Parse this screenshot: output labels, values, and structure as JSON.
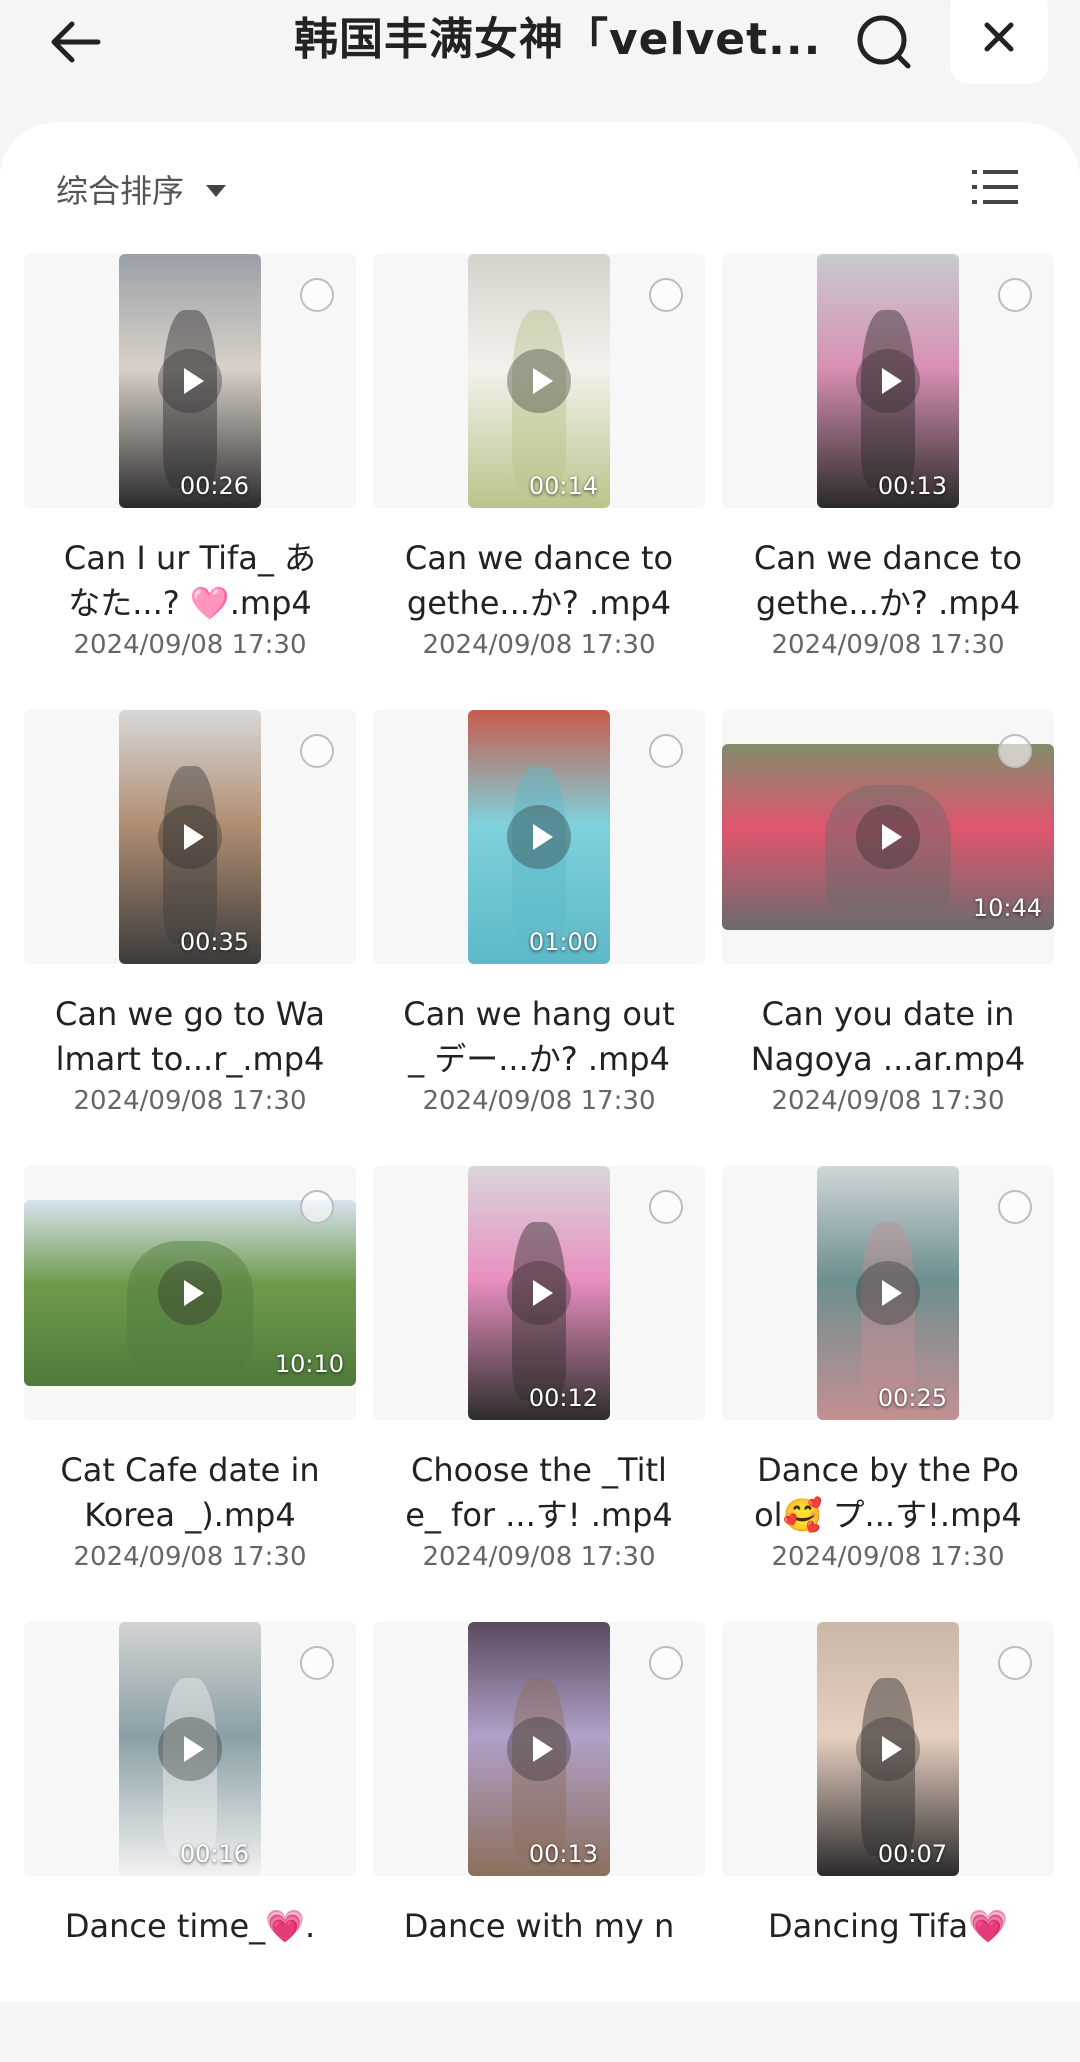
{
  "header": {
    "title": "韩国丰满女神「velvet...",
    "back_icon": "arrow-left-icon",
    "search_icon": "search-icon",
    "close_icon": "close-icon"
  },
  "toolbar": {
    "sort_label": "综合排序",
    "view_toggle_icon": "list-view-icon"
  },
  "files": [
    {
      "name": "Can I ur Tifa_ あ\nなた...? 🩷.mp4",
      "date": "2024/09/08 17:30",
      "duration": "00:26",
      "orientation": "portrait",
      "colors": [
        "#9aa0a6",
        "#2b2b2b",
        "#d9d1c9"
      ]
    },
    {
      "name": "Can we dance to\ngethe...か? .mp4",
      "date": "2024/09/08 17:30",
      "duration": "00:14",
      "orientation": "portrait",
      "colors": [
        "#d6d1cb",
        "#b9c48a",
        "#f4f1ec"
      ]
    },
    {
      "name": "Can we dance to\ngethe...か? .mp4",
      "date": "2024/09/08 17:30",
      "duration": "00:13",
      "orientation": "portrait",
      "colors": [
        "#c8cbd0",
        "#2a2a2a",
        "#d88fb4"
      ]
    },
    {
      "name": "Can we go to Wa\nlmart to...r_.mp4",
      "date": "2024/09/08 17:30",
      "duration": "00:35",
      "orientation": "portrait",
      "colors": [
        "#d8d8d8",
        "#3b3b3b",
        "#b08e72"
      ]
    },
    {
      "name": "Can we hang out\n_ デー...か? .mp4",
      "date": "2024/09/08 17:30",
      "duration": "01:00",
      "orientation": "portrait",
      "colors": [
        "#c75b4b",
        "#5db8c7",
        "#7fd1dc"
      ]
    },
    {
      "name": "Can you date in\nNagoya ...ar.mp4",
      "date": "2024/09/08 17:30",
      "duration": "10:44",
      "orientation": "landscape",
      "colors": [
        "#7f8c6a",
        "#6b6b6b",
        "#e0566f"
      ]
    },
    {
      "name": "Cat Cafe date in\nKorea _).mp4",
      "date": "2024/09/08 17:30",
      "duration": "10:10",
      "orientation": "landscape",
      "colors": [
        "#d7e3ef",
        "#4f7b3b",
        "#6f9a4c"
      ]
    },
    {
      "name": "Choose the _Titl\ne_ for ...す! .mp4",
      "date": "2024/09/08 17:30",
      "duration": "00:12",
      "orientation": "portrait",
      "colors": [
        "#d9d6dc",
        "#2d2d2d",
        "#e88fbf"
      ]
    },
    {
      "name": "Dance by the Po\nol🥰 プ...す!.mp4",
      "date": "2024/09/08 17:30",
      "duration": "00:25",
      "orientation": "portrait",
      "colors": [
        "#cfd6d9",
        "#c48f92",
        "#6d8f8f"
      ]
    },
    {
      "name": "Dance time_💗.",
      "date": "",
      "duration": "00:16",
      "orientation": "portrait",
      "colors": [
        "#d3d3d3",
        "#f2f2f2",
        "#8aa0a6"
      ]
    },
    {
      "name": "Dance with my n",
      "date": "",
      "duration": "00:13",
      "orientation": "portrait",
      "colors": [
        "#5a4a5e",
        "#8b6f5c",
        "#b1a0c8"
      ]
    },
    {
      "name": "Dancing Tifa💗",
      "date": "",
      "duration": "00:07",
      "orientation": "portrait",
      "colors": [
        "#c9b7a7",
        "#2b2b2b",
        "#e7cfc0"
      ]
    }
  ]
}
